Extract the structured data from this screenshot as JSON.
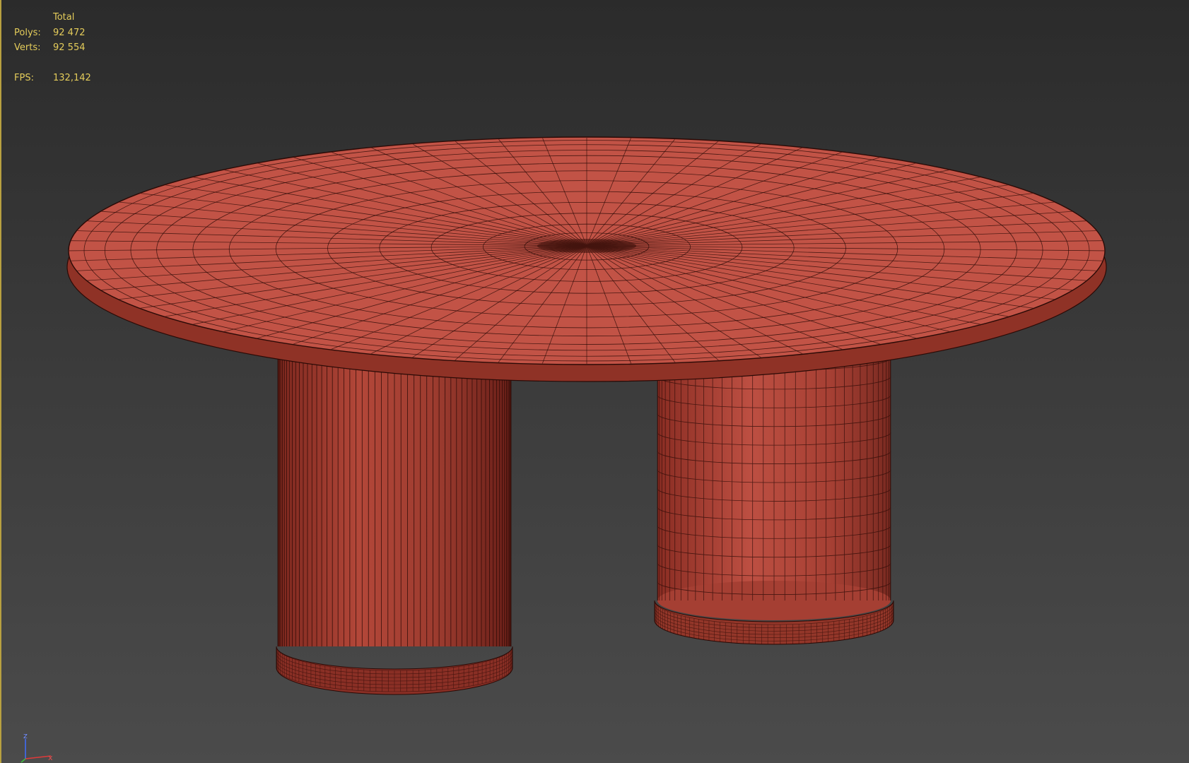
{
  "stats": {
    "header": "Total",
    "polys_label": "Polys:",
    "polys_value": "92 472",
    "verts_label": "Verts:",
    "verts_value": "92 554",
    "fps_label": "FPS:",
    "fps_value": "132,142"
  },
  "axis_gizmo": {
    "z_label": "z",
    "x_label": "x"
  },
  "colors": {
    "wire": "#2a0a06",
    "top": "#c25346",
    "side": "#8c2f25",
    "leg_light": "#b84a3d",
    "leg_dark": "#6e2119",
    "text": "#e4cc5a"
  },
  "scene": {
    "object": "table-mesh"
  }
}
